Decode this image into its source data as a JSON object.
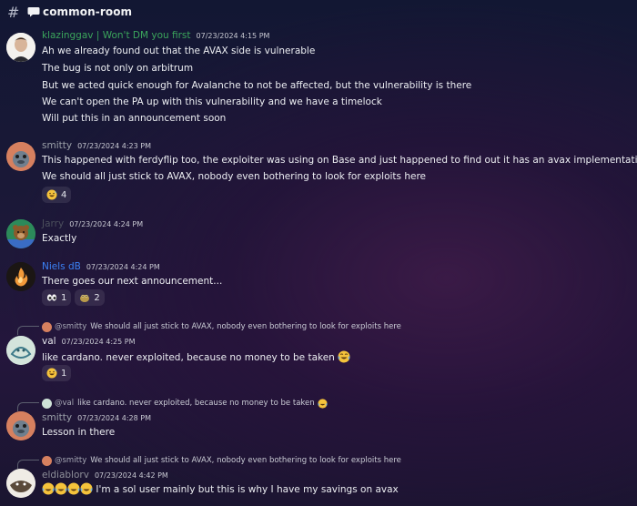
{
  "channel": {
    "name": "common-room"
  },
  "messages": [
    {
      "author": "klazinggav | Won't DM you first",
      "time": "07/23/2024 4:15 PM",
      "color": "#3ba55c",
      "lines": [
        "Ah we already found out that the AVAX side is vulnerable",
        "The bug is not only on arbitrum",
        "But we acted quick enough for Avalanche to not be affected, but the vulnerability is there",
        "We can't open the PA up with this vulnerability and we have a timelock",
        "Will put this in an announcement soon"
      ]
    },
    {
      "author": "smitty",
      "time": "07/23/2024 4:23 PM",
      "color": "#9aa0a8",
      "lines": [
        "This happened with ferdyflip too, the exploiter was using on Base and just happened to find out it has an avax implementation too",
        "We should all just stick to AVAX, nobody even bothering to look for exploits here"
      ],
      "reactions": [
        {
          "emoji": "grinning-sweat-face",
          "count": "4"
        }
      ]
    },
    {
      "author": "Jarry",
      "time": "07/23/2024 4:24 PM",
      "color": "#4b4f5c",
      "lines": [
        "Exactly"
      ]
    },
    {
      "author": "Niels dB",
      "time": "07/23/2024 4:24 PM",
      "color": "#3b82f6",
      "lines": [
        "There goes our next announcement..."
      ],
      "reactions": [
        {
          "emoji": "eyes",
          "count": "1"
        },
        {
          "emoji": "custom-frog",
          "count": "2"
        }
      ]
    },
    {
      "reply_to": {
        "name": "@smitty",
        "text": "We should all just stick to AVAX, nobody even bothering to look for exploits here"
      },
      "author": "val",
      "time": "07/23/2024 4:25 PM",
      "color": "#e6e6ec",
      "lines": [
        "like cardano. never exploited, because no money to be taken"
      ],
      "reactions": [
        {
          "emoji": "grinning-sweat-face",
          "count": "1"
        }
      ]
    },
    {
      "reply_to": {
        "name": "@val",
        "text": "like cardano. never exploited, because no money to be taken"
      },
      "author": "smitty",
      "time": "07/23/2024 4:28 PM",
      "color": "#9aa0a8",
      "lines": [
        "Lesson in there"
      ]
    },
    {
      "reply_to": {
        "name": "@smitty",
        "text": "We should all just stick to AVAX, nobody even bothering to look for exploits here"
      },
      "author": "eldiablorv",
      "time": "07/23/2024 4:42 PM",
      "color": "#8e8f99",
      "lines": [
        "I'm a sol user mainly but this is why I have my savings on avax"
      ]
    }
  ]
}
